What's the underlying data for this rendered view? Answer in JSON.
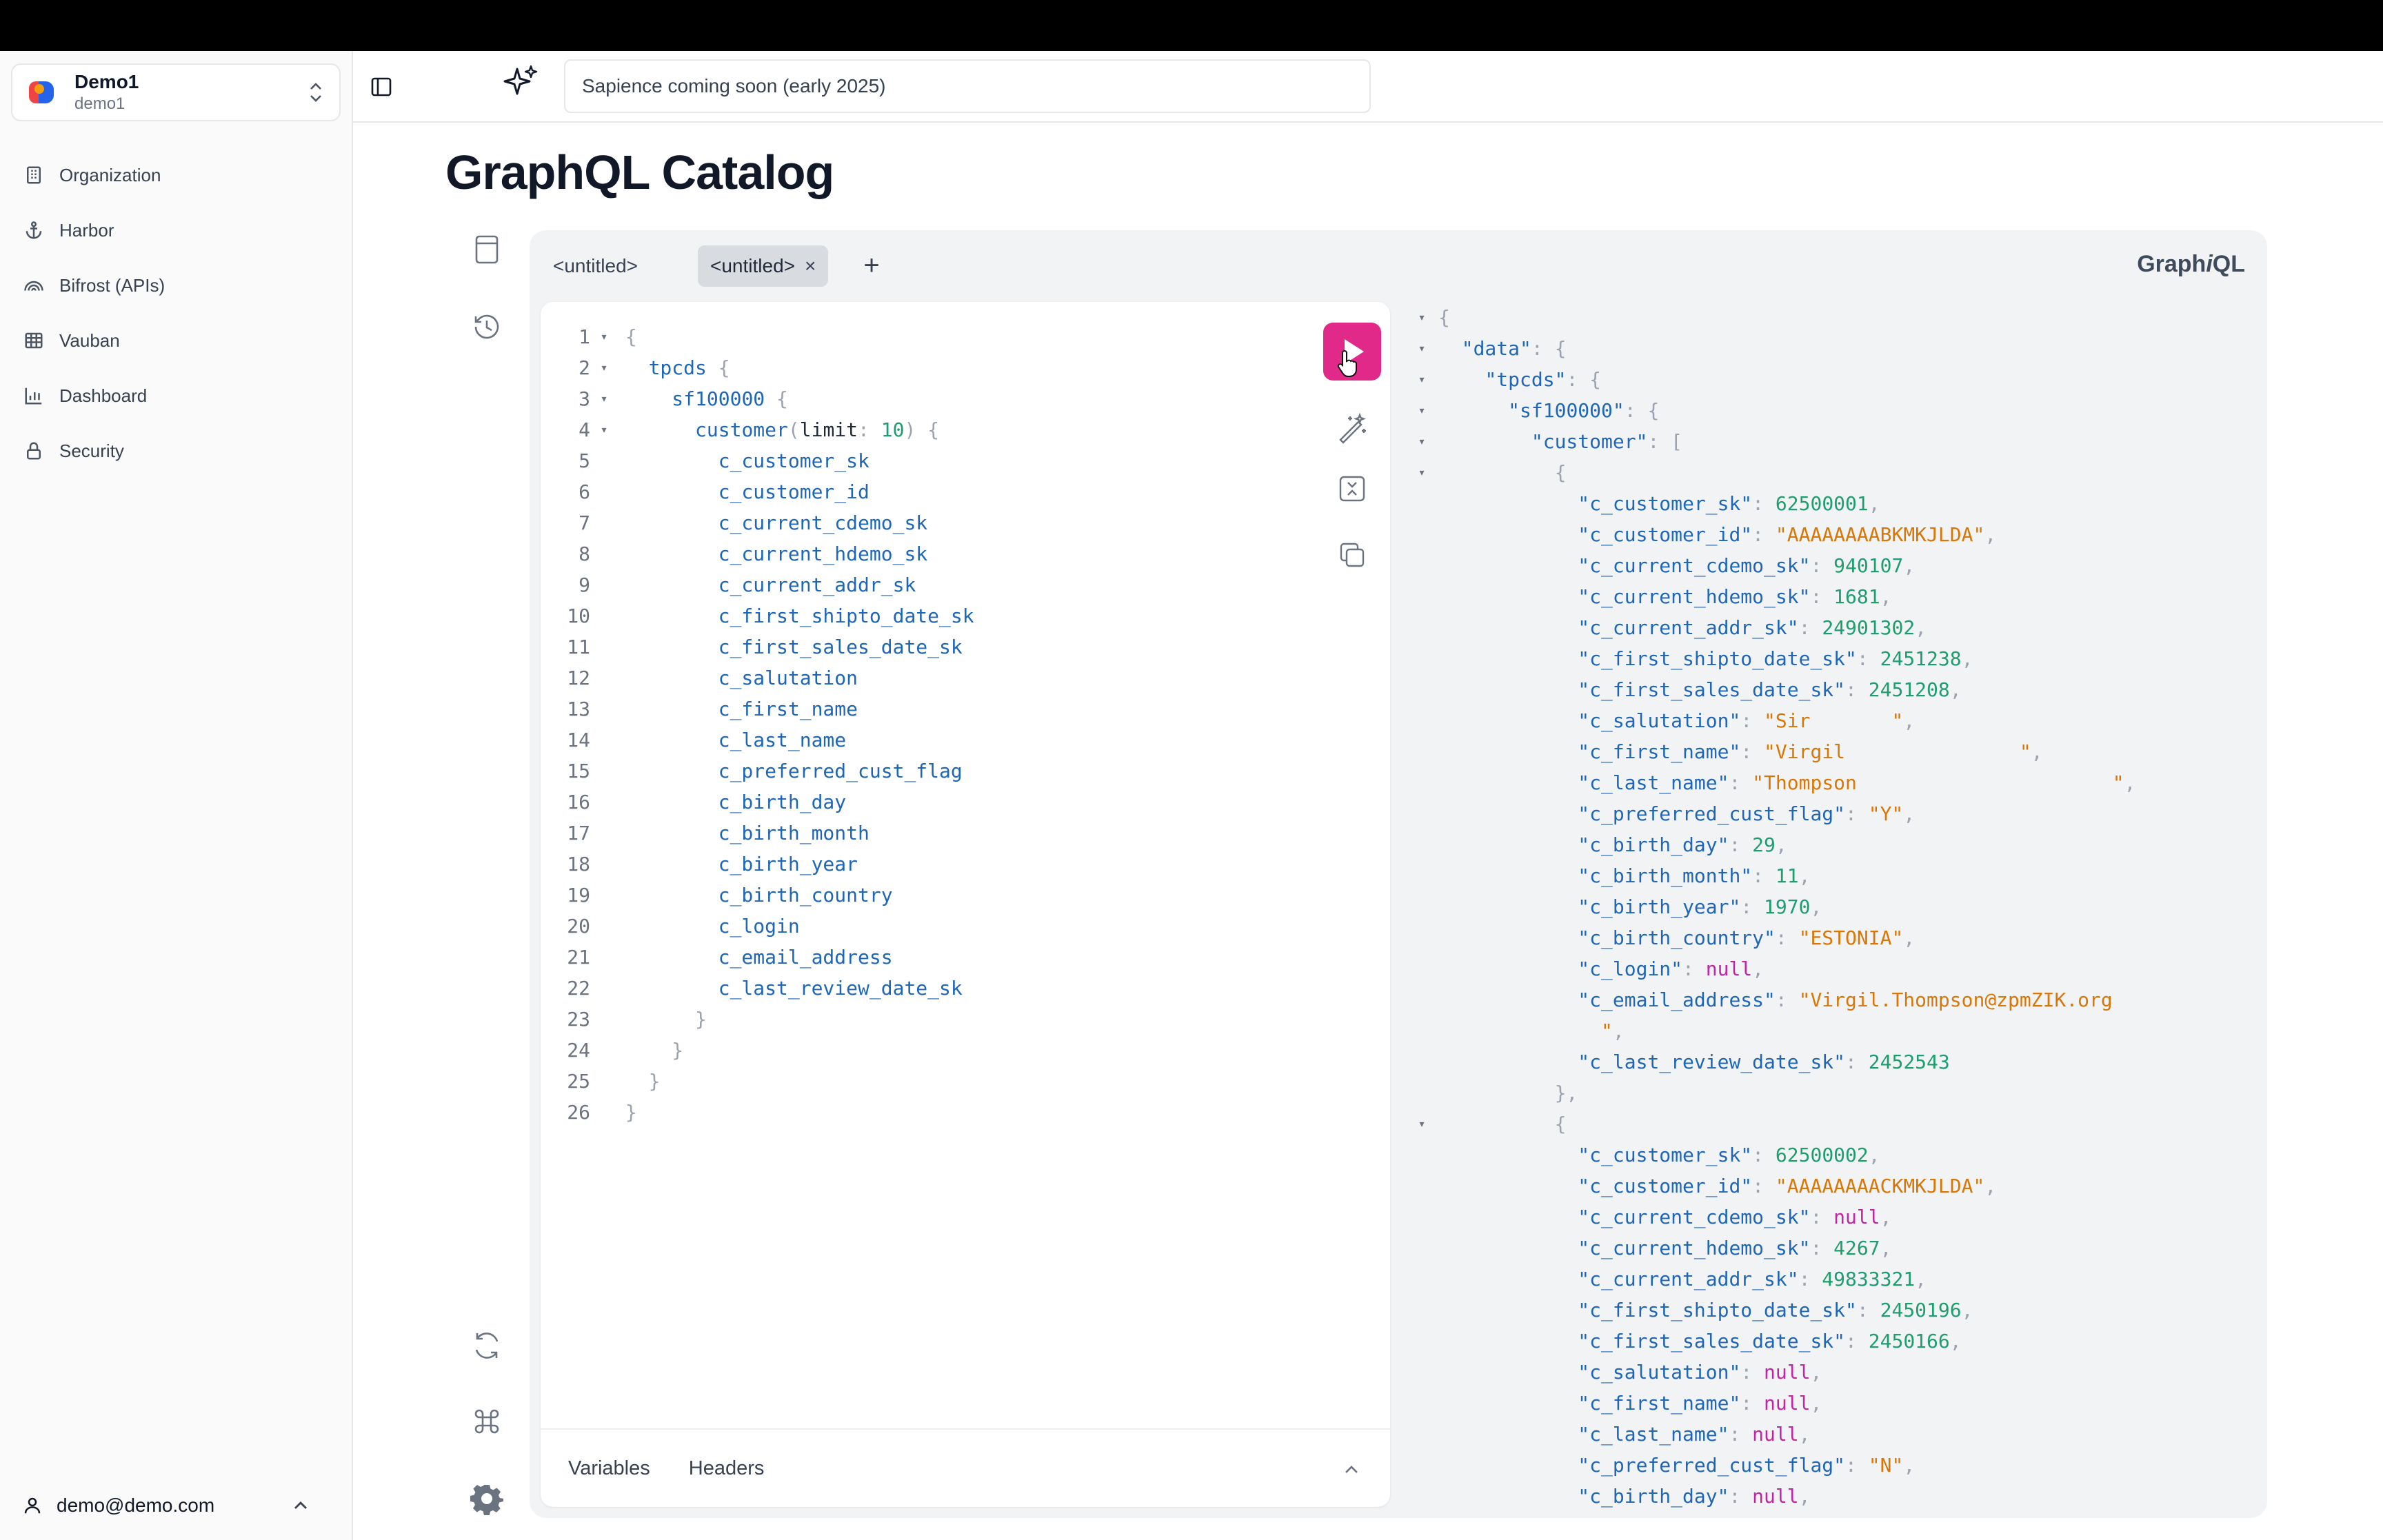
{
  "org": {
    "name": "Demo1",
    "sub": "demo1"
  },
  "nav": [
    {
      "label": "Organization",
      "icon": "building-icon"
    },
    {
      "label": "Harbor",
      "icon": "anchor-icon"
    },
    {
      "label": "Bifrost (APIs)",
      "icon": "rainbow-icon"
    },
    {
      "label": "Vauban",
      "icon": "grid-icon"
    },
    {
      "label": "Dashboard",
      "icon": "bar-chart-icon"
    },
    {
      "label": "Security",
      "icon": "lock-icon"
    }
  ],
  "user": {
    "email": "demo@demo.com"
  },
  "header": {
    "ai_placeholder": "Sapience coming soon (early 2025)"
  },
  "page": {
    "title": "GraphQL Catalog"
  },
  "graphiql": {
    "brand_pre": "Graph",
    "brand_i": "i",
    "brand_post": "QL",
    "tabs": [
      {
        "label": "<untitled>",
        "active": false
      },
      {
        "label": "<untitled>",
        "active": true,
        "close": "×"
      }
    ],
    "add_tab": "+",
    "footer": {
      "variables": "Variables",
      "headers": "Headers"
    }
  },
  "query_lines": [
    "{",
    "  tpcds {",
    "    sf100000 {",
    "      customer(limit: 10) {",
    "        c_customer_sk",
    "        c_customer_id",
    "        c_current_cdemo_sk",
    "        c_current_hdemo_sk",
    "        c_current_addr_sk",
    "        c_first_shipto_date_sk",
    "        c_first_sales_date_sk",
    "        c_salutation",
    "        c_first_name",
    "        c_last_name",
    "        c_preferred_cust_flag",
    "        c_birth_day",
    "        c_birth_month",
    "        c_birth_year",
    "        c_birth_country",
    "        c_login",
    "        c_email_address",
    "        c_last_review_date_sk",
    "      }",
    "    }",
    "  }",
    "}"
  ],
  "query_folds": [
    1,
    2,
    3,
    4
  ],
  "result_lines": [
    {
      "f": "▾",
      "i": 0,
      "t": [
        [
          "p",
          "{"
        ]
      ]
    },
    {
      "f": "▾",
      "i": 1,
      "t": [
        [
          "k",
          "\"data\""
        ],
        [
          "p",
          ": {"
        ]
      ]
    },
    {
      "f": "▾",
      "i": 2,
      "t": [
        [
          "k",
          "\"tpcds\""
        ],
        [
          "p",
          ": {"
        ]
      ]
    },
    {
      "f": "▾",
      "i": 3,
      "t": [
        [
          "k",
          "\"sf100000\""
        ],
        [
          "p",
          ": {"
        ]
      ]
    },
    {
      "f": "▾",
      "i": 4,
      "t": [
        [
          "k",
          "\"customer\""
        ],
        [
          "p",
          ": ["
        ]
      ]
    },
    {
      "f": "▾",
      "i": 5,
      "t": [
        [
          "p",
          "{"
        ]
      ]
    },
    {
      "f": "",
      "i": 6,
      "t": [
        [
          "k",
          "\"c_customer_sk\""
        ],
        [
          "p",
          ": "
        ],
        [
          "n",
          "62500001"
        ],
        [
          "p",
          ","
        ]
      ]
    },
    {
      "f": "",
      "i": 6,
      "t": [
        [
          "k",
          "\"c_customer_id\""
        ],
        [
          "p",
          ": "
        ],
        [
          "s",
          "\"AAAAAAAABKMKJLDA\""
        ],
        [
          "p",
          ","
        ]
      ]
    },
    {
      "f": "",
      "i": 6,
      "t": [
        [
          "k",
          "\"c_current_cdemo_sk\""
        ],
        [
          "p",
          ": "
        ],
        [
          "n",
          "940107"
        ],
        [
          "p",
          ","
        ]
      ]
    },
    {
      "f": "",
      "i": 6,
      "t": [
        [
          "k",
          "\"c_current_hdemo_sk\""
        ],
        [
          "p",
          ": "
        ],
        [
          "n",
          "1681"
        ],
        [
          "p",
          ","
        ]
      ]
    },
    {
      "f": "",
      "i": 6,
      "t": [
        [
          "k",
          "\"c_current_addr_sk\""
        ],
        [
          "p",
          ": "
        ],
        [
          "n",
          "24901302"
        ],
        [
          "p",
          ","
        ]
      ]
    },
    {
      "f": "",
      "i": 6,
      "t": [
        [
          "k",
          "\"c_first_shipto_date_sk\""
        ],
        [
          "p",
          ": "
        ],
        [
          "n",
          "2451238"
        ],
        [
          "p",
          ","
        ]
      ]
    },
    {
      "f": "",
      "i": 6,
      "t": [
        [
          "k",
          "\"c_first_sales_date_sk\""
        ],
        [
          "p",
          ": "
        ],
        [
          "n",
          "2451208"
        ],
        [
          "p",
          ","
        ]
      ]
    },
    {
      "f": "",
      "i": 6,
      "t": [
        [
          "k",
          "\"c_salutation\""
        ],
        [
          "p",
          ": "
        ],
        [
          "s",
          "\"Sir       \""
        ],
        [
          "p",
          ","
        ]
      ]
    },
    {
      "f": "",
      "i": 6,
      "t": [
        [
          "k",
          "\"c_first_name\""
        ],
        [
          "p",
          ": "
        ],
        [
          "s",
          "\"Virgil               \""
        ],
        [
          "p",
          ","
        ]
      ]
    },
    {
      "f": "",
      "i": 6,
      "t": [
        [
          "k",
          "\"c_last_name\""
        ],
        [
          "p",
          ": "
        ],
        [
          "s",
          "\"Thompson                      \""
        ],
        [
          "p",
          ","
        ]
      ]
    },
    {
      "f": "",
      "i": 6,
      "t": [
        [
          "k",
          "\"c_preferred_cust_flag\""
        ],
        [
          "p",
          ": "
        ],
        [
          "s",
          "\"Y\""
        ],
        [
          "p",
          ","
        ]
      ]
    },
    {
      "f": "",
      "i": 6,
      "t": [
        [
          "k",
          "\"c_birth_day\""
        ],
        [
          "p",
          ": "
        ],
        [
          "n",
          "29"
        ],
        [
          "p",
          ","
        ]
      ]
    },
    {
      "f": "",
      "i": 6,
      "t": [
        [
          "k",
          "\"c_birth_month\""
        ],
        [
          "p",
          ": "
        ],
        [
          "n",
          "11"
        ],
        [
          "p",
          ","
        ]
      ]
    },
    {
      "f": "",
      "i": 6,
      "t": [
        [
          "k",
          "\"c_birth_year\""
        ],
        [
          "p",
          ": "
        ],
        [
          "n",
          "1970"
        ],
        [
          "p",
          ","
        ]
      ]
    },
    {
      "f": "",
      "i": 6,
      "t": [
        [
          "k",
          "\"c_birth_country\""
        ],
        [
          "p",
          ": "
        ],
        [
          "s",
          "\"ESTONIA\""
        ],
        [
          "p",
          ","
        ]
      ]
    },
    {
      "f": "",
      "i": 6,
      "t": [
        [
          "k",
          "\"c_login\""
        ],
        [
          "p",
          ": "
        ],
        [
          "nl",
          "null"
        ],
        [
          "p",
          ","
        ]
      ]
    },
    {
      "f": "",
      "i": 6,
      "t": [
        [
          "k",
          "\"c_email_address\""
        ],
        [
          "p",
          ": "
        ],
        [
          "s",
          "\"Virgil.Thompson@zpmZIK.org"
        ]
      ]
    },
    {
      "f": "",
      "i": 7,
      "t": [
        [
          "s",
          "\""
        ],
        [
          "p",
          ","
        ]
      ]
    },
    {
      "f": "",
      "i": 6,
      "t": [
        [
          "k",
          "\"c_last_review_date_sk\""
        ],
        [
          "p",
          ": "
        ],
        [
          "n",
          "2452543"
        ]
      ]
    },
    {
      "f": "",
      "i": 5,
      "t": [
        [
          "p",
          "},"
        ]
      ]
    },
    {
      "f": "▾",
      "i": 5,
      "t": [
        [
          "p",
          "{"
        ]
      ]
    },
    {
      "f": "",
      "i": 6,
      "t": [
        [
          "k",
          "\"c_customer_sk\""
        ],
        [
          "p",
          ": "
        ],
        [
          "n",
          "62500002"
        ],
        [
          "p",
          ","
        ]
      ]
    },
    {
      "f": "",
      "i": 6,
      "t": [
        [
          "k",
          "\"c_customer_id\""
        ],
        [
          "p",
          ": "
        ],
        [
          "s",
          "\"AAAAAAAACKMKJLDA\""
        ],
        [
          "p",
          ","
        ]
      ]
    },
    {
      "f": "",
      "i": 6,
      "t": [
        [
          "k",
          "\"c_current_cdemo_sk\""
        ],
        [
          "p",
          ": "
        ],
        [
          "nl",
          "null"
        ],
        [
          "p",
          ","
        ]
      ]
    },
    {
      "f": "",
      "i": 6,
      "t": [
        [
          "k",
          "\"c_current_hdemo_sk\""
        ],
        [
          "p",
          ": "
        ],
        [
          "n",
          "4267"
        ],
        [
          "p",
          ","
        ]
      ]
    },
    {
      "f": "",
      "i": 6,
      "t": [
        [
          "k",
          "\"c_current_addr_sk\""
        ],
        [
          "p",
          ": "
        ],
        [
          "n",
          "49833321"
        ],
        [
          "p",
          ","
        ]
      ]
    },
    {
      "f": "",
      "i": 6,
      "t": [
        [
          "k",
          "\"c_first_shipto_date_sk\""
        ],
        [
          "p",
          ": "
        ],
        [
          "n",
          "2450196"
        ],
        [
          "p",
          ","
        ]
      ]
    },
    {
      "f": "",
      "i": 6,
      "t": [
        [
          "k",
          "\"c_first_sales_date_sk\""
        ],
        [
          "p",
          ": "
        ],
        [
          "n",
          "2450166"
        ],
        [
          "p",
          ","
        ]
      ]
    },
    {
      "f": "",
      "i": 6,
      "t": [
        [
          "k",
          "\"c_salutation\""
        ],
        [
          "p",
          ": "
        ],
        [
          "nl",
          "null"
        ],
        [
          "p",
          ","
        ]
      ]
    },
    {
      "f": "",
      "i": 6,
      "t": [
        [
          "k",
          "\"c_first_name\""
        ],
        [
          "p",
          ": "
        ],
        [
          "nl",
          "null"
        ],
        [
          "p",
          ","
        ]
      ]
    },
    {
      "f": "",
      "i": 6,
      "t": [
        [
          "k",
          "\"c_last_name\""
        ],
        [
          "p",
          ": "
        ],
        [
          "nl",
          "null"
        ],
        [
          "p",
          ","
        ]
      ]
    },
    {
      "f": "",
      "i": 6,
      "t": [
        [
          "k",
          "\"c_preferred_cust_flag\""
        ],
        [
          "p",
          ": "
        ],
        [
          "s",
          "\"N\""
        ],
        [
          "p",
          ","
        ]
      ]
    },
    {
      "f": "",
      "i": 6,
      "t": [
        [
          "k",
          "\"c_birth_day\""
        ],
        [
          "p",
          ": "
        ],
        [
          "nl",
          "null"
        ],
        [
          "p",
          ","
        ]
      ]
    }
  ],
  "colors": {
    "run": "#e1298a",
    "key": "#1e66b8",
    "string": "#d97706",
    "number": "#1e9e6e",
    "null": "#c026a3"
  }
}
